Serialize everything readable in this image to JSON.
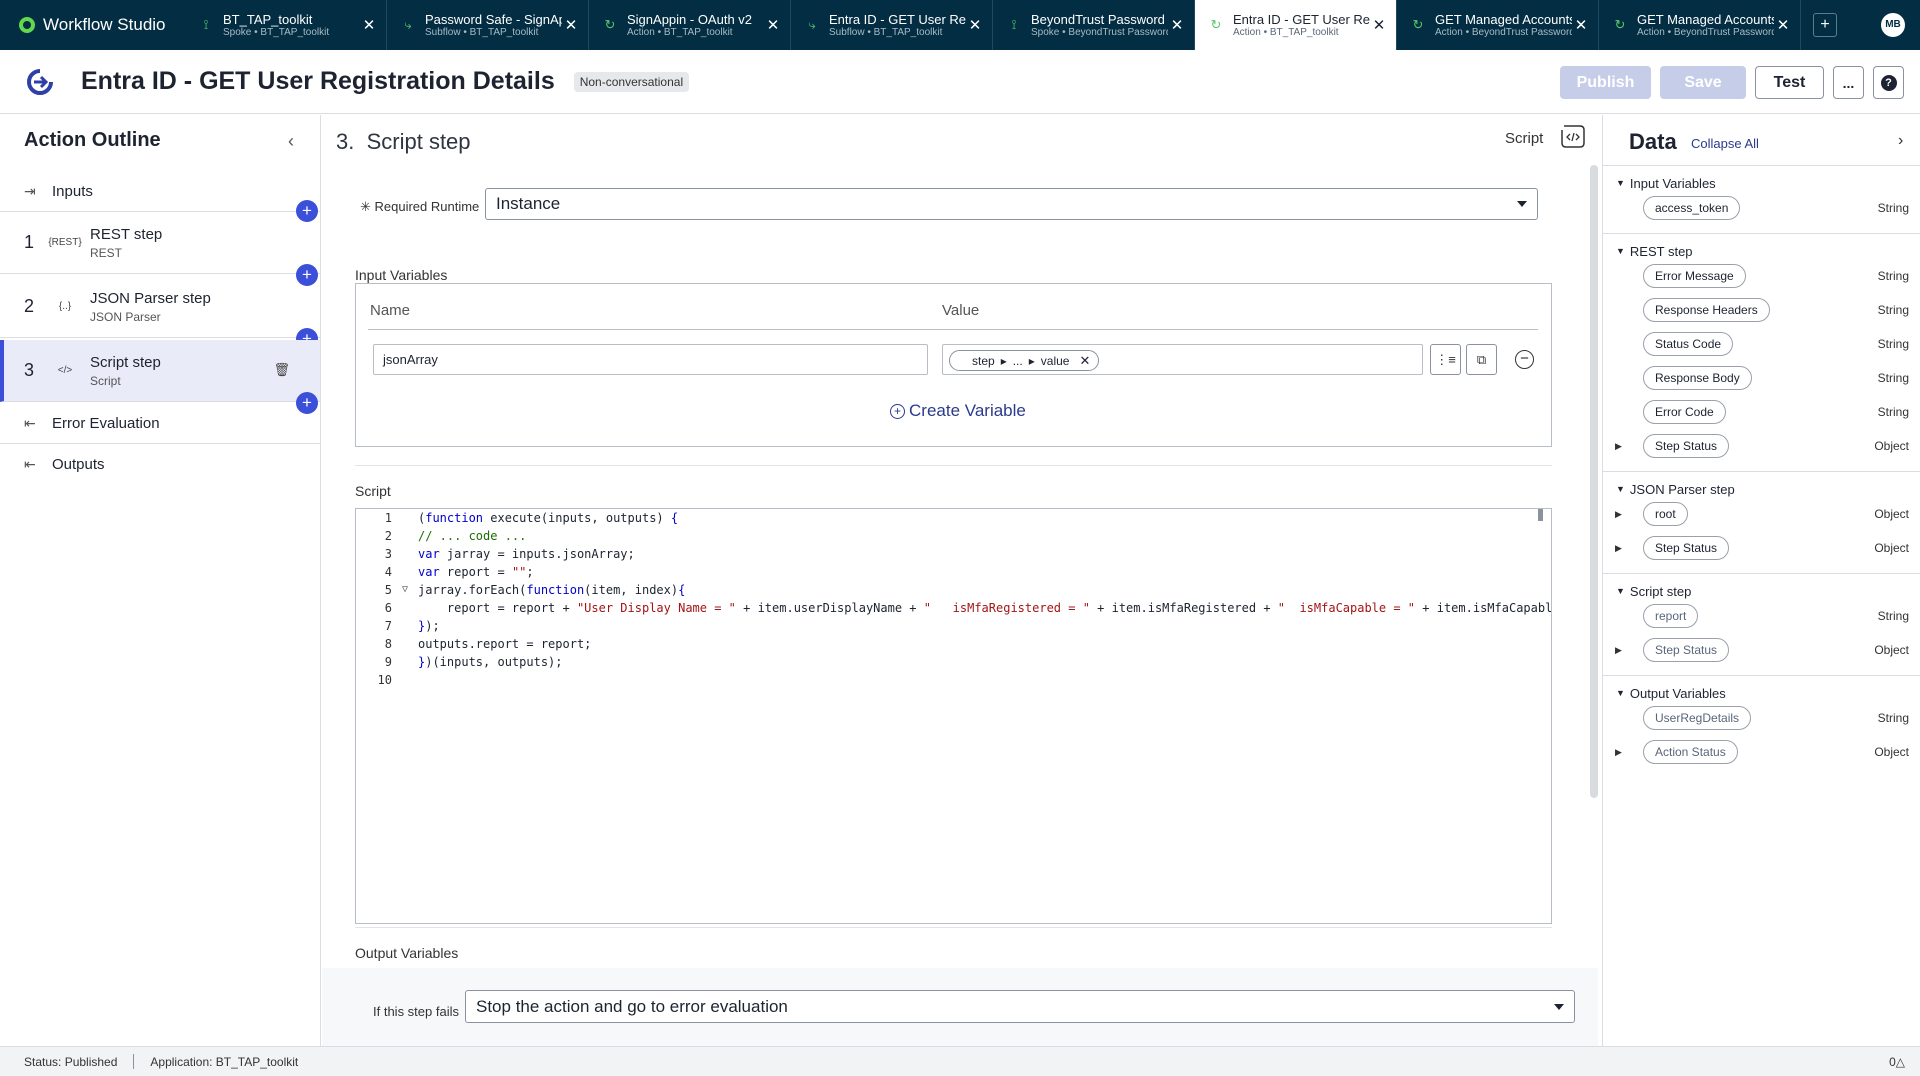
{
  "app": {
    "name": "Workflow Studio",
    "user_initials": "MB"
  },
  "tabs": [
    {
      "name": "BT_TAP_toolkit",
      "sub": "Spoke • BT_TAP_toolkit",
      "icon": "spoke-icon"
    },
    {
      "name": "Password Safe - SignApp",
      "sub": "Subflow • BT_TAP_toolkit",
      "icon": "subflow-icon"
    },
    {
      "name": "SignAppin - OAuth v2",
      "sub": "Action • BT_TAP_toolkit",
      "icon": "action-icon"
    },
    {
      "name": "Entra ID - GET User Registration",
      "sub": "Subflow • BT_TAP_toolkit",
      "icon": "subflow-icon"
    },
    {
      "name": "BeyondTrust Password Safe",
      "sub": "Spoke • BeyondTrust Password Safe",
      "icon": "spoke-icon"
    },
    {
      "name": "Entra ID - GET User Registration Details",
      "sub": "Action • BT_TAP_toolkit",
      "icon": "action-icon",
      "active": true
    },
    {
      "name": "GET Managed Accounts",
      "sub": "Action • BeyondTrust Password Safe",
      "icon": "action-icon"
    },
    {
      "name": "GET Managed Accounts",
      "sub": "Action • BeyondTrust Password Safe",
      "icon": "action-icon"
    }
  ],
  "header": {
    "title": "Entra ID - GET User Registration Details",
    "badge": "Non-conversational",
    "publish": "Publish",
    "save": "Save",
    "test": "Test",
    "more": "...",
    "help": "?"
  },
  "outline": {
    "title": "Action Outline",
    "inputs": "Inputs",
    "steps": [
      {
        "num": "1",
        "name": "REST step",
        "type": "REST",
        "icon_text": "{REST}"
      },
      {
        "num": "2",
        "name": "JSON Parser step",
        "type": "JSON Parser",
        "icon_text": "{..}"
      },
      {
        "num": "3",
        "name": "Script step",
        "type": "Script",
        "icon_text": "</>"
      }
    ],
    "error_evaluation": "Error Evaluation",
    "outputs": "Outputs"
  },
  "step": {
    "number": "3.",
    "title": "Script step",
    "type_label": "Script",
    "runtime_label": "Required Runtime",
    "runtime_value": "Instance",
    "input_vars_label": "Input Variables",
    "col_name": "Name",
    "col_value": "Value",
    "var_name": "jsonArray",
    "pill_step": "step",
    "pill_ellipsis": "...",
    "pill_value": "value",
    "create_variable": "Create Variable",
    "script_label": "Script",
    "output_vars_label": "Output Variables",
    "fail_label": "If this step fails",
    "fail_value": "Stop the action and go to error evaluation"
  },
  "code_lines": [
    "(function execute(inputs, outputs) {",
    "// ... code ...",
    "var jarray = inputs.jsonArray;",
    "var report = \"\";",
    "jarray.forEach(function(item, index){",
    "    report = report + \"User Display Name = \" + item.userDisplayName + \"   isMfaRegistered = \" + item.isMfaRegistered + \"  isMfaCapable = \" + item.isMfaCapabl",
    "});",
    "outputs.report = report;",
    "})(inputs, outputs);",
    ""
  ],
  "data_panel": {
    "title": "Data",
    "collapse_all": "Collapse All",
    "sections": [
      {
        "title": "Input Variables",
        "items": [
          {
            "name": "access_token",
            "type": "String"
          }
        ]
      },
      {
        "title": "REST step",
        "items": [
          {
            "name": "Error Message",
            "type": "String"
          },
          {
            "name": "Response Headers",
            "type": "String"
          },
          {
            "name": "Status Code",
            "type": "String"
          },
          {
            "name": "Response Body",
            "type": "String"
          },
          {
            "name": "Error Code",
            "type": "String"
          },
          {
            "name": "Step Status",
            "type": "Object",
            "expandable": true
          }
        ]
      },
      {
        "title": "JSON Parser step",
        "items": [
          {
            "name": "root",
            "type": "Object",
            "expandable": true
          },
          {
            "name": "Step Status",
            "type": "Object",
            "expandable": true
          }
        ]
      },
      {
        "title": "Script step",
        "items": [
          {
            "name": "report",
            "type": "String",
            "disabled": true
          },
          {
            "name": "Step Status",
            "type": "Object",
            "expandable": true,
            "disabled": true
          }
        ]
      },
      {
        "title": "Output Variables",
        "items": [
          {
            "name": "UserRegDetails",
            "type": "String",
            "disabled": true
          },
          {
            "name": "Action Status",
            "type": "Object",
            "expandable": true,
            "disabled": true
          }
        ]
      }
    ]
  },
  "status": {
    "status": "Status: Published",
    "application": "Application: BT_TAP_toolkit",
    "right": "0"
  }
}
